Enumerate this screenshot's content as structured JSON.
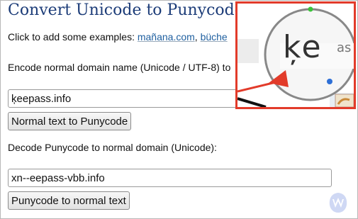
{
  "page": {
    "title": "Convert Unicode to Punycode",
    "examples_prefix": "Click to add some examples:",
    "example_links": [
      "mañana.com",
      "büche"
    ],
    "encode_label": "Encode normal domain name (Unicode / UTF-8) to",
    "unicode_input_value": "ķeepass.info",
    "encode_button": "Normal text to Punycode",
    "decode_label": "Decode Punycode to normal domain (Unicode):",
    "punycode_input_value": "xn--eepass-vbb.info",
    "decode_button": "Punycode to normal text"
  },
  "zoom_callout": {
    "magnified_text": "ķe",
    "magnified_text_trailing": "as",
    "border_color": "#e23b2a"
  },
  "icons": {
    "watermark": "malwarebytes-logo-icon",
    "arrow": "red-pointer-arrow-icon"
  }
}
